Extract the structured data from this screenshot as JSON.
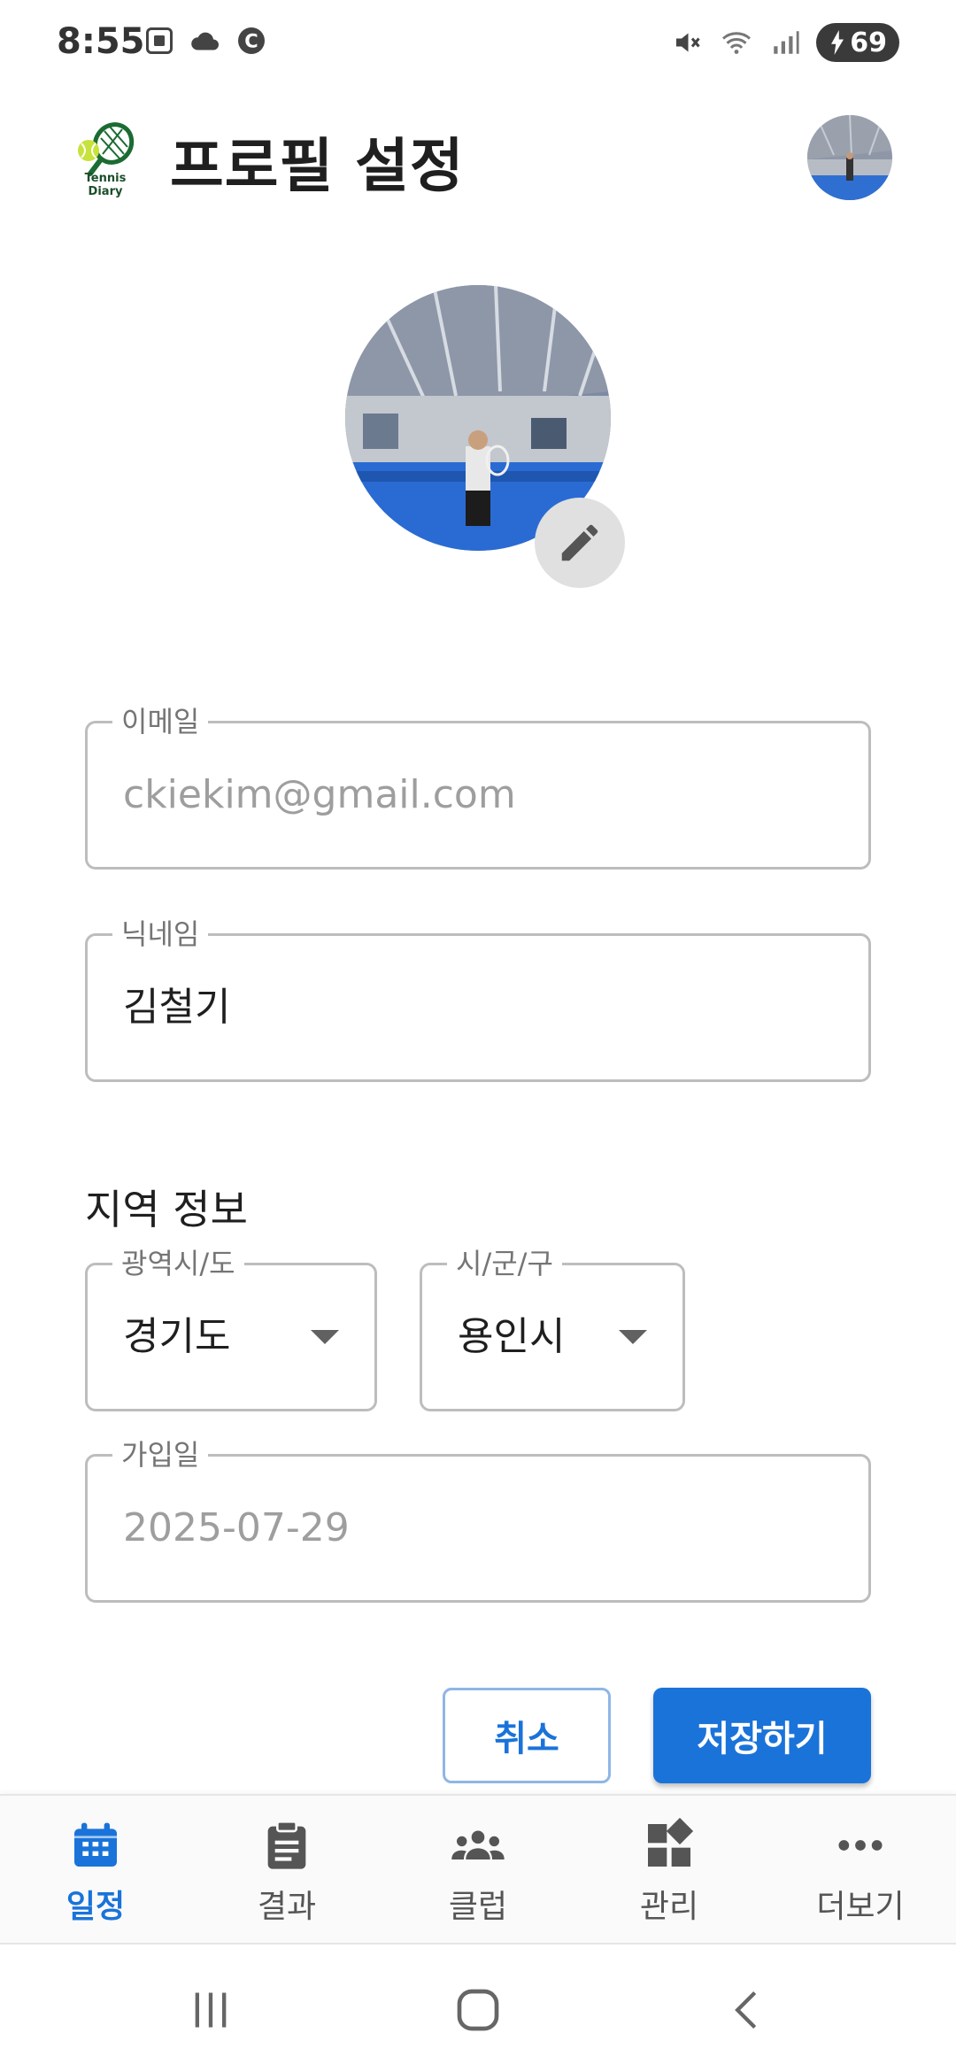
{
  "status_bar": {
    "time": "8:55",
    "battery": "69",
    "icons": [
      "screenshot-icon",
      "cloud-icon",
      "c-icon",
      "mute-icon",
      "wifi-icon",
      "signal-icon",
      "battery-charging-icon"
    ]
  },
  "app_bar": {
    "logo_text": "Tennis Diary",
    "title": "프로필 설정"
  },
  "form": {
    "email": {
      "label": "이메일",
      "value": "ckiekim@gmail.com"
    },
    "nickname": {
      "label": "닉네임",
      "value": "김철기"
    },
    "region_title": "지역 정보",
    "province": {
      "label": "광역시/도",
      "value": "경기도"
    },
    "city": {
      "label": "시/군/구",
      "value": "용인시"
    },
    "join_date": {
      "label": "가입일",
      "value": "2025-07-29"
    }
  },
  "buttons": {
    "cancel": "취소",
    "save": "저장하기"
  },
  "bottom_nav": [
    {
      "label": "일정",
      "icon": "calendar-icon",
      "active": true
    },
    {
      "label": "결과",
      "icon": "clipboard-icon",
      "active": false
    },
    {
      "label": "클럽",
      "icon": "groups-icon",
      "active": false
    },
    {
      "label": "관리",
      "icon": "dashboard-icon",
      "active": false
    },
    {
      "label": "더보기",
      "icon": "more-horiz-icon",
      "active": false
    }
  ],
  "colors": {
    "primary": "#1a73d9",
    "outline": "#bdbdbd",
    "label": "#757575"
  }
}
